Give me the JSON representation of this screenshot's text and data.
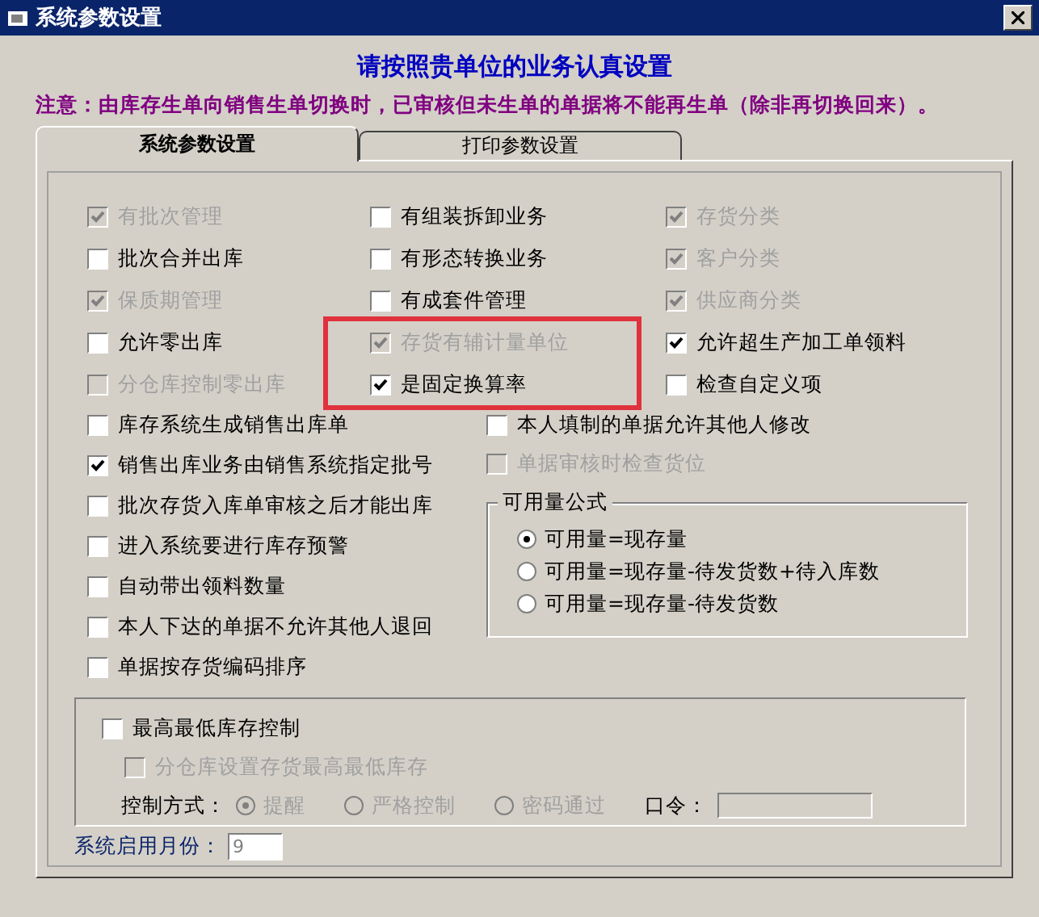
{
  "window": {
    "title": "系统参数设置"
  },
  "heading": "请按照贵单位的业务认真设置",
  "notice": "注意：由库存生单向销售生单切换时，已审核但未生单的单据将不能再生单（除非再切换回来）。",
  "tabs": [
    {
      "label": "系统参数设置",
      "selected": true
    },
    {
      "label": "打印参数设置",
      "selected": false
    }
  ],
  "option_columns": [
    [
      {
        "label": "有批次管理",
        "checked": true,
        "disabled": true,
        "highlighted": false
      },
      {
        "label": "批次合并出库",
        "checked": false,
        "disabled": false,
        "highlighted": false
      },
      {
        "label": "保质期管理",
        "checked": true,
        "disabled": true,
        "highlighted": false
      },
      {
        "label": "允许零出库",
        "checked": false,
        "disabled": false,
        "highlighted": false
      },
      {
        "label": "分仓库控制零出库",
        "checked": false,
        "disabled": true,
        "highlighted": false
      }
    ],
    [
      {
        "label": "有组装拆卸业务",
        "checked": false,
        "disabled": false,
        "highlighted": false
      },
      {
        "label": "有形态转换业务",
        "checked": false,
        "disabled": false,
        "highlighted": false
      },
      {
        "label": "有成套件管理",
        "checked": false,
        "disabled": false,
        "highlighted": false
      },
      {
        "label": "存货有辅计量单位",
        "checked": true,
        "disabled": true,
        "highlighted": true
      },
      {
        "label": "是固定换算率",
        "checked": true,
        "disabled": false,
        "highlighted": true
      }
    ],
    [
      {
        "label": "存货分类",
        "checked": true,
        "disabled": true,
        "highlighted": false
      },
      {
        "label": "客户分类",
        "checked": true,
        "disabled": true,
        "highlighted": false
      },
      {
        "label": "供应商分类",
        "checked": true,
        "disabled": true,
        "highlighted": false
      },
      {
        "label": "允许超生产加工单领料",
        "checked": true,
        "disabled": false,
        "highlighted": false
      },
      {
        "label": "检查自定义项",
        "checked": false,
        "disabled": false,
        "highlighted": false
      }
    ]
  ],
  "left_options": [
    {
      "label": "库存系统生成销售出库单",
      "checked": false,
      "disabled": false
    },
    {
      "label": "销售出库业务由销售系统指定批号",
      "checked": true,
      "disabled": false
    },
    {
      "label": "批次存货入库单审核之后才能出库",
      "checked": false,
      "disabled": false
    },
    {
      "label": "进入系统要进行库存预警",
      "checked": false,
      "disabled": false
    },
    {
      "label": "自动带出领料数量",
      "checked": false,
      "disabled": false
    },
    {
      "label": "本人下达的单据不允许其他人退回",
      "checked": false,
      "disabled": false
    },
    {
      "label": "单据按存货编码排序",
      "checked": false,
      "disabled": false
    }
  ],
  "right_options": [
    {
      "label": "本人填制的单据允许其他人修改",
      "checked": false,
      "disabled": false
    },
    {
      "label": "单据审核时检查货位",
      "checked": false,
      "disabled": true
    }
  ],
  "formula_group": {
    "title": "可用量公式",
    "options": [
      {
        "label": "可用量=现存量",
        "selected": true
      },
      {
        "label": "可用量=现存量-待发货数+待入库数",
        "selected": false
      },
      {
        "label": "可用量=现存量-待发货数",
        "selected": false
      }
    ]
  },
  "stock_limit": {
    "main": {
      "label": "最高最低库存控制",
      "checked": false,
      "disabled": false
    },
    "sub": {
      "label": "分仓库设置存货最高最低库存",
      "checked": false,
      "disabled": true
    },
    "method_label": "控制方式：",
    "methods": [
      {
        "label": "提醒",
        "selected": true,
        "disabled": true
      },
      {
        "label": "严格控制",
        "selected": false,
        "disabled": true
      },
      {
        "label": "密码通过",
        "selected": false,
        "disabled": true
      }
    ],
    "password_label": "口令：",
    "password_disabled": true
  },
  "start_month": {
    "label": "系统启用月份：",
    "value": "9"
  }
}
